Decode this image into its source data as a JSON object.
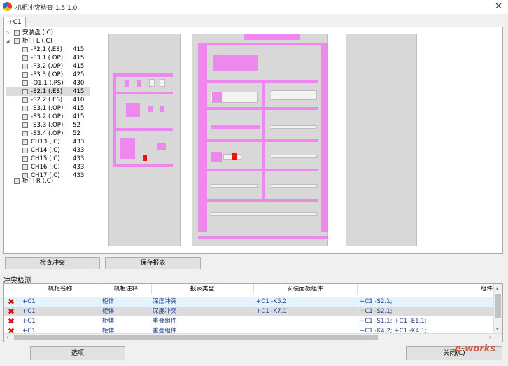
{
  "window": {
    "title": "机柜冲突检查 1.5.1.0",
    "close_glyph": "✕"
  },
  "tab": {
    "label": "+C1"
  },
  "tree": {
    "root1": {
      "name": "安装盘 (.C)"
    },
    "root2": {
      "name": "柜门 L (.C)"
    },
    "children": [
      {
        "name": "-P2.1 (.ES)",
        "value": "415"
      },
      {
        "name": "-P3.1 (.OP)",
        "value": "415"
      },
      {
        "name": "-P3.2 (.OP)",
        "value": "415"
      },
      {
        "name": "-P3.3 (.OP)",
        "value": "425"
      },
      {
        "name": "-Q1.1 (.PS)",
        "value": "430"
      },
      {
        "name": "-S2.1 (.ES)",
        "value": "415",
        "selected": true
      },
      {
        "name": "-S2.2 (.ES)",
        "value": "410"
      },
      {
        "name": "-S3.1 (.OP)",
        "value": "415"
      },
      {
        "name": "-S3.2 (.OP)",
        "value": "415"
      },
      {
        "name": "-S3.3 (.OP)",
        "value": "52"
      },
      {
        "name": "-S3.4 (.OP)",
        "value": "52"
      },
      {
        "name": "CH13 (.C)",
        "value": "433"
      },
      {
        "name": "CH14 (.C)",
        "value": "433"
      },
      {
        "name": "CH15 (.C)",
        "value": "433"
      },
      {
        "name": "CH16 (.C)",
        "value": "433"
      },
      {
        "name": "CH17 (.C)",
        "value": "433"
      }
    ],
    "root3": {
      "name": "柜门 R (.C)"
    }
  },
  "buttons": {
    "check": "检查冲突",
    "save": "保存报表",
    "options": "选项",
    "close": "关闭(C)"
  },
  "conflicts": {
    "section_label": "冲突检测",
    "columns": [
      "机柜名称",
      "机柜注释",
      "报表类型",
      "安装面板组件",
      "组件"
    ],
    "rows": [
      {
        "cabinet": "+C1",
        "note": "柜体",
        "type": "深度冲突",
        "panel": "+C1 -K5.2",
        "component": "+C1 -S2.1;"
      },
      {
        "cabinet": "+C1",
        "note": "柜体",
        "type": "深度冲突",
        "panel": "+C1 -K7.1",
        "component": "+C1 -S2.1;"
      },
      {
        "cabinet": "+C1",
        "note": "柜体",
        "type": "重叠组件",
        "panel": "",
        "component": "+C1 -S1.1; +C1 -E1.1;"
      },
      {
        "cabinet": "+C1",
        "note": "柜体",
        "type": "重叠组件",
        "panel": "",
        "component": "+C1 -K4.2; +C1 -K4.1;"
      }
    ]
  },
  "watermark": "e-works",
  "colors": {
    "highlight_pink": "#ee88ee",
    "conflict_red": "#ee1111",
    "row_text": "#1a3f8f"
  }
}
